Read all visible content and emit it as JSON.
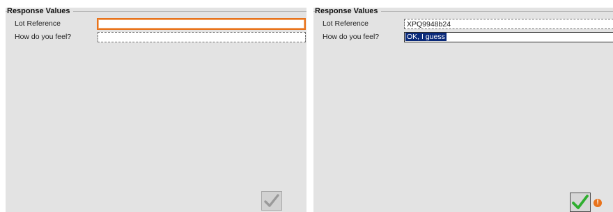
{
  "left_panel": {
    "group_title": "Response Values",
    "fields": [
      {
        "label": "Lot Reference",
        "value": ""
      },
      {
        "label": "How do you feel?",
        "value": ""
      }
    ],
    "submit_state": "disabled",
    "submit_icon": "checkmark-icon"
  },
  "right_panel": {
    "group_title": "Response Values",
    "fields": [
      {
        "label": "Lot Reference",
        "value": "XPQ9948b24"
      },
      {
        "label": "How do you feel?",
        "value": "OK, I guess"
      }
    ],
    "submit_state": "enabled",
    "submit_icon": "checkmark-icon",
    "warning_icon": "exclamation-icon",
    "warning_glyph": "!"
  },
  "colors": {
    "panel_bg": "#e3e3e3",
    "focus_orange": "#e8731c",
    "selection_bg": "#0a2a7a",
    "check_green": "#2fae2f",
    "check_gray": "#9a9a9a"
  }
}
